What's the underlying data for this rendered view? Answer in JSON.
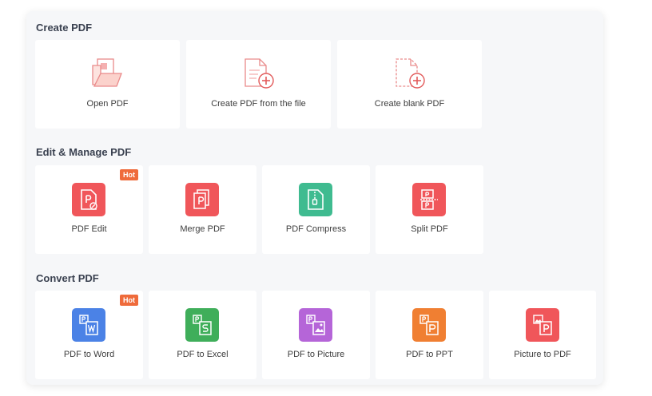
{
  "sections": {
    "create": {
      "title": "Create PDF",
      "items": [
        {
          "label": "Open PDF",
          "icon": "open-folder-icon"
        },
        {
          "label": "Create PDF from the file",
          "icon": "file-plus-icon"
        },
        {
          "label": "Create blank PDF",
          "icon": "blank-page-plus-icon"
        }
      ]
    },
    "edit": {
      "title": "Edit & Manage PDF",
      "items": [
        {
          "label": "PDF Edit",
          "icon": "pdf-edit-icon",
          "color": "#f0565a",
          "badge": "Hot"
        },
        {
          "label": "Merge PDF",
          "icon": "merge-pdf-icon",
          "color": "#f0565a"
        },
        {
          "label": "PDF Compress",
          "icon": "compress-pdf-icon",
          "color": "#3fbb90"
        },
        {
          "label": "Split PDF",
          "icon": "split-pdf-icon",
          "color": "#f0565a"
        }
      ]
    },
    "convert": {
      "title": "Convert PDF",
      "items": [
        {
          "label": "PDF to Word",
          "icon": "pdf-to-word-icon",
          "color": "#4b82e6",
          "badge": "Hot"
        },
        {
          "label": "PDF to Excel",
          "icon": "pdf-to-excel-icon",
          "color": "#3fae5a"
        },
        {
          "label": "PDF to Picture",
          "icon": "pdf-to-picture-icon",
          "color": "#b565d8"
        },
        {
          "label": "PDF to PPT",
          "icon": "pdf-to-ppt-icon",
          "color": "#f07f32"
        },
        {
          "label": "Picture to PDF",
          "icon": "picture-to-pdf-icon",
          "color": "#f0565a"
        }
      ]
    }
  }
}
